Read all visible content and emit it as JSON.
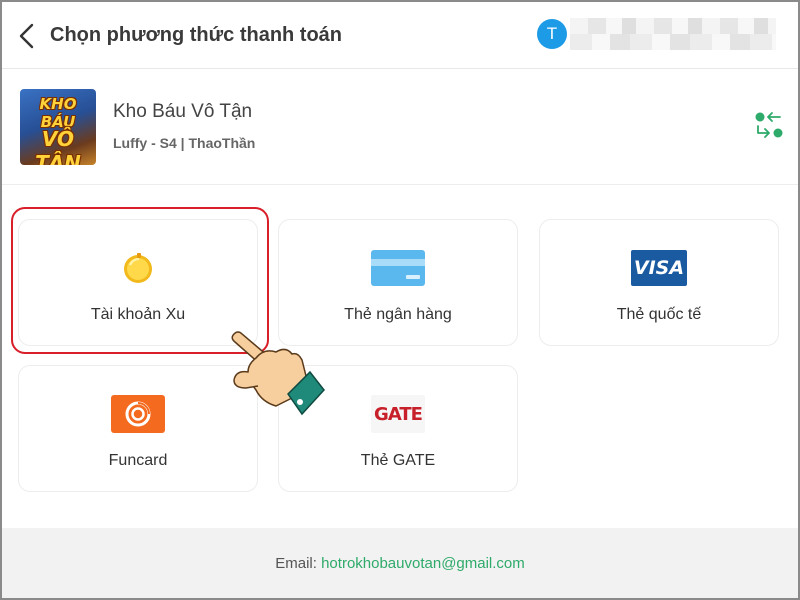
{
  "header": {
    "title": "Chọn phương thức thanh toán",
    "avatar_letter": "T"
  },
  "game": {
    "logo_text_top": "KHO BÁU",
    "logo_text_bottom": "VÔ TẬN",
    "name": "Kho Báu Vô Tận",
    "server": "Luffy - S4 | ThaoThần"
  },
  "payment_methods": [
    {
      "label": "Tài khoản Xu",
      "icon": "coin-icon",
      "selected": true
    },
    {
      "label": "Thẻ ngân hàng",
      "icon": "bank-card-icon"
    },
    {
      "label": "Thẻ quốc tế",
      "icon": "visa-icon",
      "icon_text": "VISA"
    },
    {
      "label": "Funcard",
      "icon": "funcard-icon"
    },
    {
      "label": "Thẻ GATE",
      "icon": "gate-icon",
      "icon_text": "GATE"
    }
  ],
  "footer": {
    "email_label": "Email:",
    "email": "hotrokhobauvotan@gmail.com"
  },
  "colors": {
    "accent_green": "#2eaa6a",
    "avatar_blue": "#1e9be6",
    "highlight_red": "#d81f2a",
    "visa_blue": "#1a5aa0",
    "funcard_orange": "#f46a1e",
    "gate_red": "#c8202a"
  }
}
